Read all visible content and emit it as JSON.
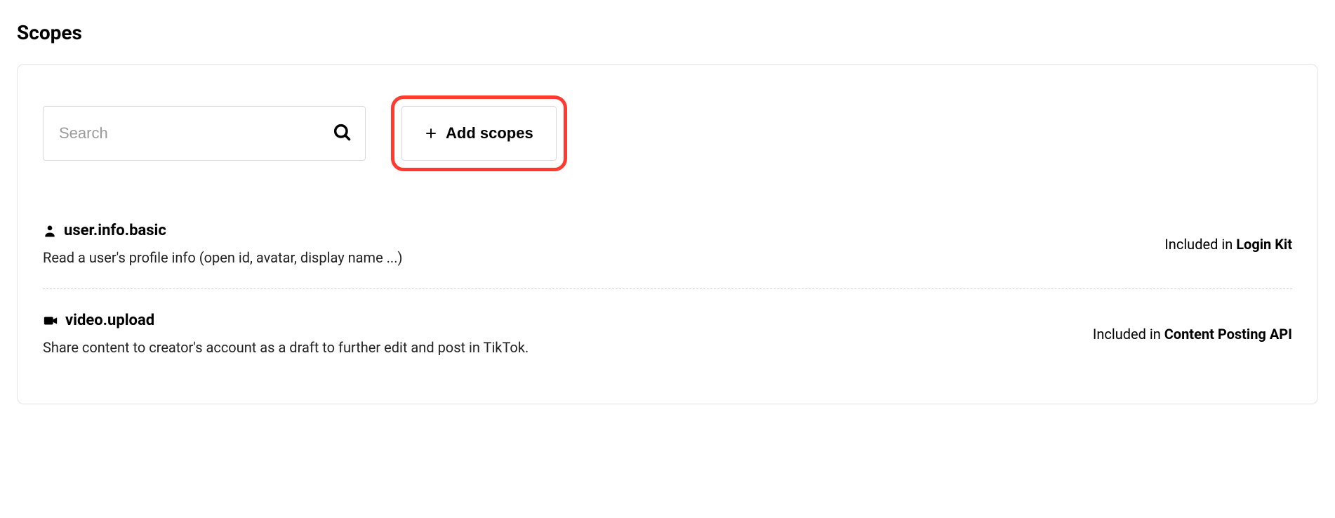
{
  "page": {
    "title": "Scopes"
  },
  "search": {
    "placeholder": "Search",
    "value": ""
  },
  "toolbar": {
    "add_scopes_label": "Add scopes"
  },
  "included_prefix": "Included in ",
  "scopes": [
    {
      "icon": "user-icon",
      "name": "user.info.basic",
      "description": "Read a user's profile info (open id, avatar, display name ...)",
      "included_in": "Login Kit"
    },
    {
      "icon": "video-icon",
      "name": "video.upload",
      "description": "Share content to creator's account as a draft to further edit and post in TikTok.",
      "included_in": "Content Posting API"
    }
  ]
}
